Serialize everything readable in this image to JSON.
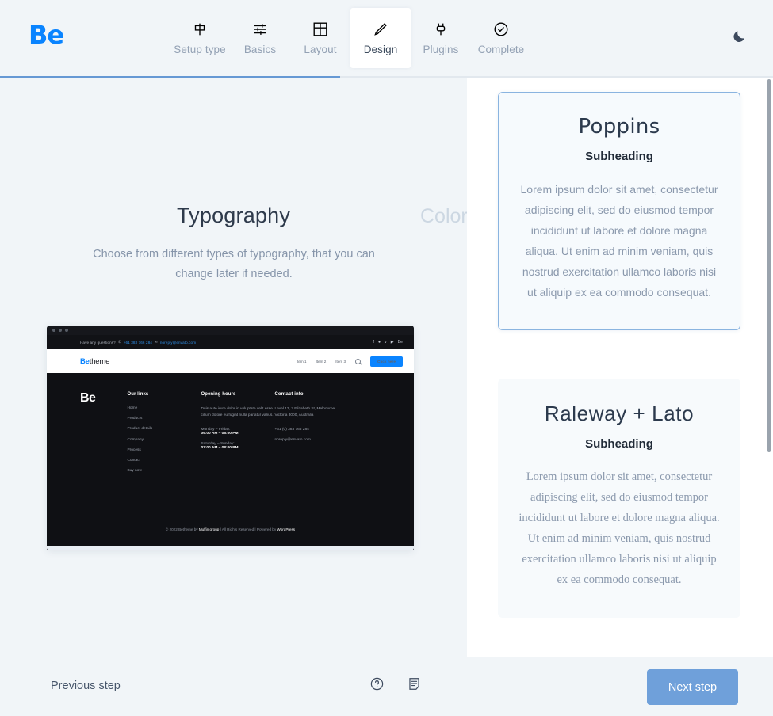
{
  "header": {
    "logo": "Be",
    "dark_mode_icon": "moon-icon",
    "steps": [
      {
        "label": "Setup type",
        "icon": "signpost-icon",
        "active": false
      },
      {
        "label": "Basics",
        "icon": "sliders-icon",
        "active": false
      },
      {
        "label": "Layout",
        "icon": "grid-icon",
        "active": false
      },
      {
        "label": "Design",
        "icon": "pencil-icon",
        "active": true
      },
      {
        "label": "Plugins",
        "icon": "plug-icon",
        "active": false
      },
      {
        "label": "Complete",
        "icon": "check-circle-icon",
        "active": false
      }
    ]
  },
  "progress": {
    "percent_label": "44%",
    "percent": 44,
    "fill_color": "#6699d4"
  },
  "left": {
    "slide_title": "Typography",
    "next_slide_title": "Colors",
    "description": "Choose from different types of typography, that you can change later if needed."
  },
  "mockup": {
    "topbar": {
      "question": "Have any questions?",
      "phone_icon": "phone-icon",
      "phone": "+61 383 766 284",
      "mail_icon": "mail-icon",
      "email": "noreply@envato.com",
      "socials": [
        "facebook-icon",
        "twitter-icon",
        "vimeo-icon",
        "youtube-icon",
        "behance-icon"
      ]
    },
    "nav": {
      "logo_bold": "Be",
      "logo_rest": "theme",
      "menu": [
        "Item 1",
        "Item 2",
        "Item 3"
      ],
      "search_icon": "search-icon",
      "cta": "Click here"
    },
    "footer": {
      "brand": "Be",
      "columns": [
        {
          "heading": "Our links",
          "links": [
            "Home",
            "Products",
            "Product details",
            "Company",
            "Process",
            "Contact",
            "Buy now"
          ]
        },
        {
          "heading": "Opening hours",
          "paragraph": "Duis aute irure dolor in voluptate velit esse cillum dolore eu fugiat nulla pariatur varius.",
          "hours": [
            {
              "label": "Monday – Friday:",
              "value": "09:00 AM – 06:00 PM"
            },
            {
              "label": "Saturday – Sunday:",
              "value": "07:00 AM – 08:00 PM"
            }
          ]
        },
        {
          "heading": "Contact info",
          "address": "Level 13, 2 Elizabeth St, Melbourne, Victoria 3000, Australia",
          "phone": "+61 (0) 383 766 284",
          "email": "noreply@envato.com"
        }
      ],
      "copyright_pre": "© 2022 Betheme by ",
      "copyright_link": "Muffin group",
      "copyright_post": " | All Rights Reserved | Powered by ",
      "copyright_link2": "WordPress"
    }
  },
  "right": {
    "cards": [
      {
        "title": "Poppins",
        "subheading": "Subheading",
        "body": "Lorem ipsum dolor sit amet, consectetur adipiscing elit, sed do eiusmod tempor incididunt ut labore et dolore magna aliqua. Ut enim ad minim veniam, quis nostrud exercitation ullamco laboris nisi ut aliquip ex ea commodo consequat.",
        "selected": true
      },
      {
        "title": "Raleway + Lato",
        "subheading": "Subheading",
        "body": "Lorem ipsum dolor sit amet, consectetur adipiscing elit, sed do eiusmod tempor incididunt ut labore et dolore magna aliqua. Ut enim ad minim veniam, quis nostrud exercitation ullamco laboris nisi ut aliquip ex ea commodo consequat.",
        "selected": false
      }
    ],
    "selected_border_color": "#8ab4e0"
  },
  "bottom": {
    "previous_label": "Previous step",
    "next_label": "Next step",
    "next_color": "#6fa0da",
    "help_icon": "question-circle-icon",
    "notes_icon": "note-icon"
  }
}
